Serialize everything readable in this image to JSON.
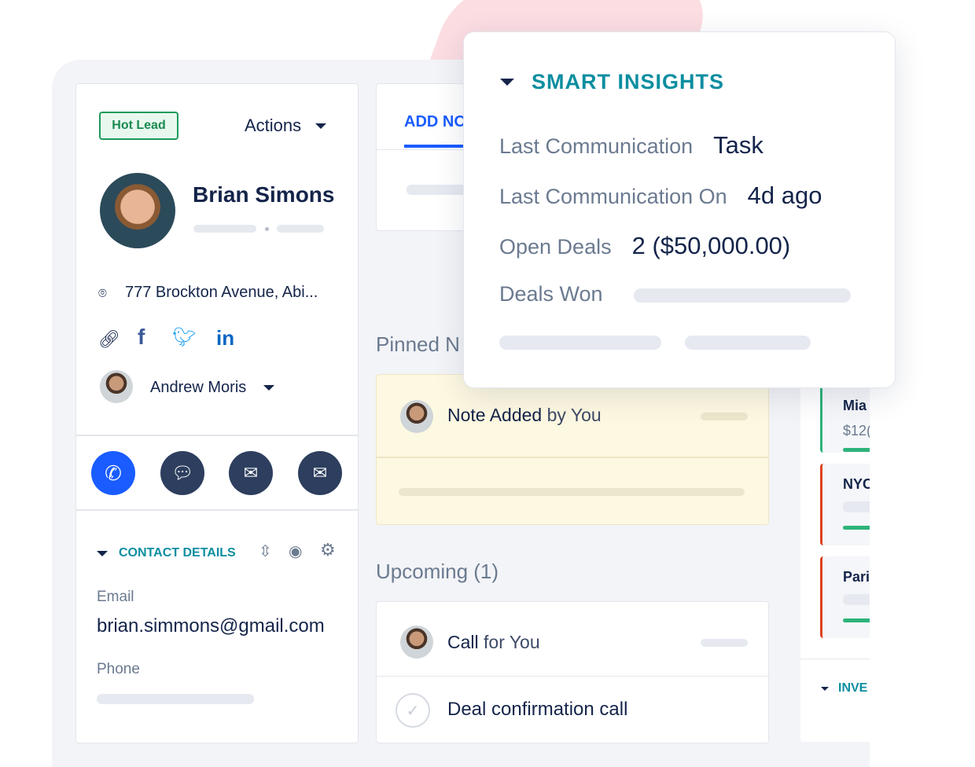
{
  "contact": {
    "badge": "Hot Lead",
    "actions_label": "Actions",
    "name": "Brian Simons",
    "address": "777 Brockton Avenue, Abi...",
    "owner": "Andrew Moris"
  },
  "contact_details": {
    "title": "CONTACT DETAILS",
    "email_label": "Email",
    "email_value": "brian.simmons@gmail.com",
    "phone_label": "Phone"
  },
  "middle": {
    "tab_label": "ADD NO",
    "pinned_title": "Pinned N",
    "note_title": "Note Added",
    "note_by": "by You",
    "upcoming_title": "Upcoming (1)",
    "call_title": "Call",
    "call_for": "for You",
    "task_title": "Deal confirmation call"
  },
  "deals": [
    {
      "name": "Mia",
      "amount": "$12(",
      "color": "#2db37a"
    },
    {
      "name": "NYC",
      "color": "#e0401f"
    },
    {
      "name": "Pari",
      "color": "#e0401f"
    }
  ],
  "right_section": "INVE",
  "insights": {
    "title": "SMART INSIGHTS",
    "rows": [
      {
        "label": "Last Communication",
        "value": "Task"
      },
      {
        "label": "Last Communication On",
        "value": "4d ago"
      },
      {
        "label": "Open Deals",
        "value": "2 ($50,000.00)"
      },
      {
        "label": "Deals Won",
        "value": ""
      }
    ]
  },
  "colors": {
    "accent": "#1a5cff",
    "teal": "#0b8ea0",
    "hot_lead": "#1a9a5a"
  }
}
